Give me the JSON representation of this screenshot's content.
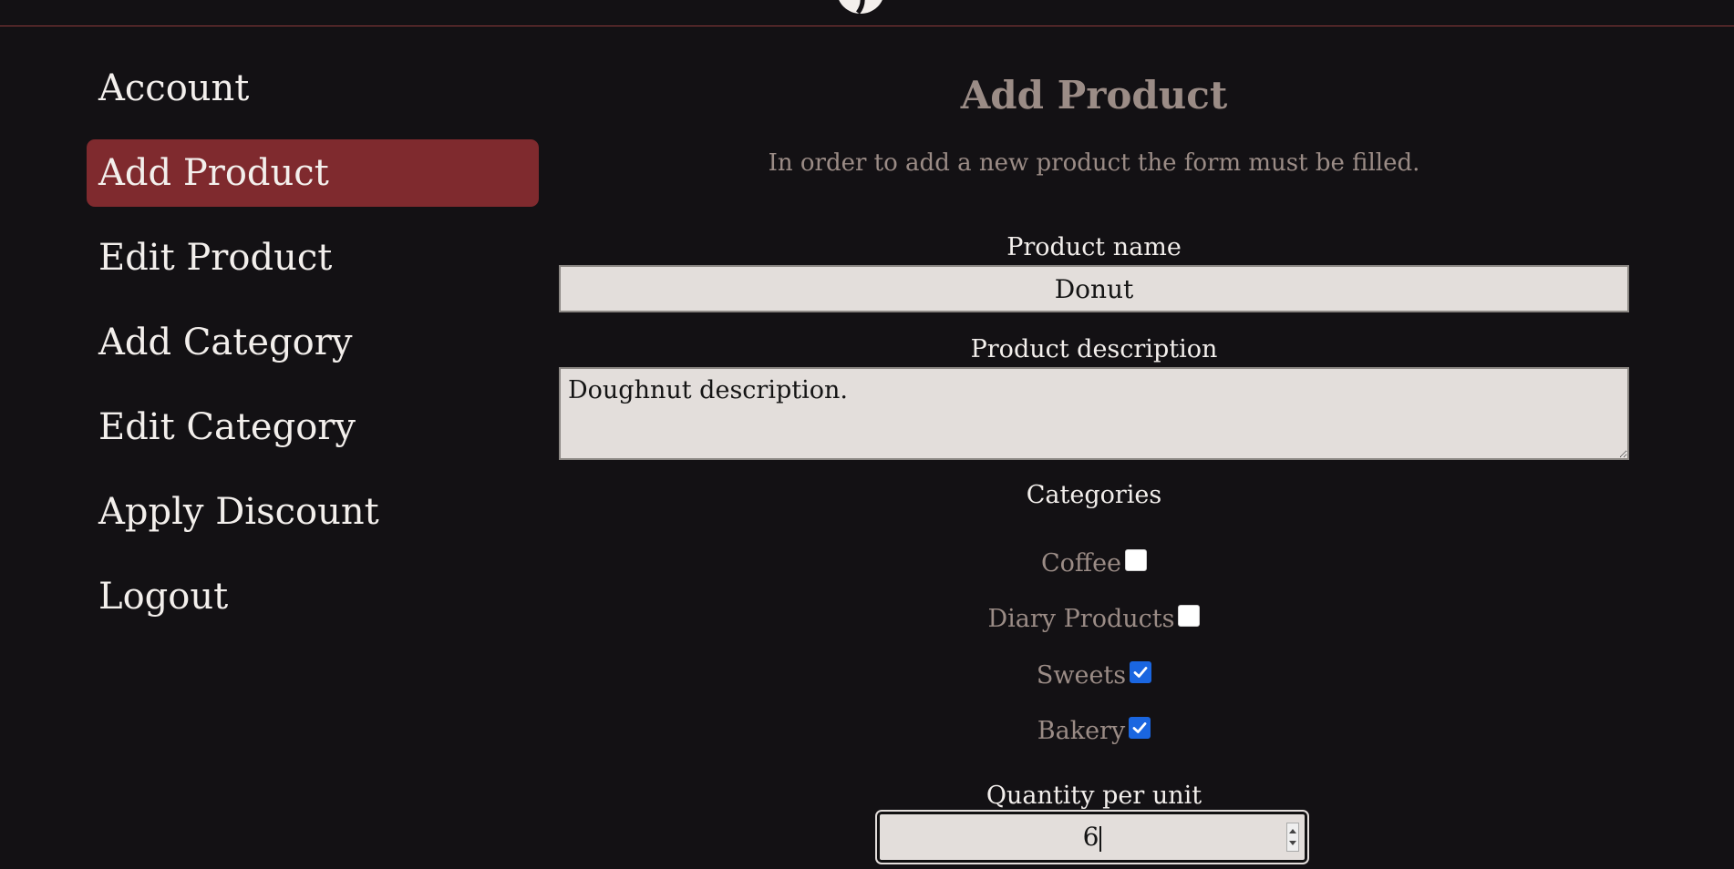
{
  "sidebar": {
    "items": [
      {
        "label": "Account",
        "active": false
      },
      {
        "label": "Add Product",
        "active": true
      },
      {
        "label": "Edit Product",
        "active": false
      },
      {
        "label": "Add Category",
        "active": false
      },
      {
        "label": "Edit Category",
        "active": false
      },
      {
        "label": "Apply Discount",
        "active": false
      },
      {
        "label": "Logout",
        "active": false
      }
    ]
  },
  "main": {
    "title": "Add Product",
    "subtitle": "In order to add a new product the form must be filled.",
    "product_name": {
      "label": "Product name",
      "value": "Donut"
    },
    "product_description": {
      "label": "Product description",
      "value": "Doughnut description."
    },
    "categories": {
      "label": "Categories",
      "items": [
        {
          "label": "Coffee",
          "checked": false
        },
        {
          "label": "Diary Products",
          "checked": false
        },
        {
          "label": "Sweets",
          "checked": true
        },
        {
          "label": "Bakery",
          "checked": true
        }
      ]
    },
    "quantity": {
      "label": "Quantity per unit",
      "value": "6"
    }
  },
  "colors": {
    "background": "#131114",
    "accent": "#7f2a2e",
    "muted_text": "#9b8c86",
    "input_bg": "#e3dedb",
    "checkbox_checked": "#1a66e0"
  },
  "icons": {
    "logo": "coffee-bean-logo-icon",
    "check": "check-icon"
  }
}
